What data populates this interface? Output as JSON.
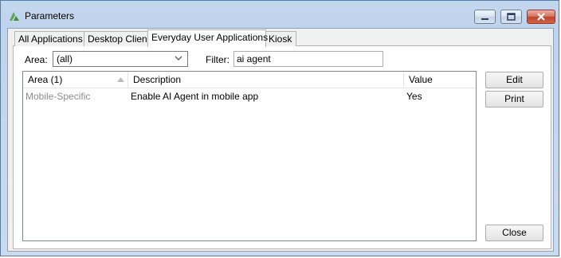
{
  "window": {
    "title": "Parameters",
    "icon": "app-logo-icon",
    "controls": [
      "minimize-icon",
      "maximize-icon",
      "close-icon"
    ]
  },
  "tabs": [
    {
      "label": "All Applications",
      "active": false
    },
    {
      "label": "Desktop Client",
      "active": false
    },
    {
      "label": "Everyday User Applications",
      "active": true
    },
    {
      "label": "Kiosk",
      "active": false
    }
  ],
  "filters": {
    "area_label": "Area:",
    "area_value": "(all)",
    "filter_label": "Filter:",
    "filter_value": "ai agent"
  },
  "grid": {
    "columns": [
      "Area (1)",
      "Description",
      "Value"
    ],
    "sort_column": "Area (1)",
    "rows": [
      {
        "area": "Mobile-Specific",
        "description": "Enable AI Agent in mobile app",
        "value": "Yes"
      }
    ]
  },
  "buttons": {
    "edit": "Edit",
    "print": "Print",
    "close": "Close"
  },
  "colors": {
    "frame": "#c3d7ee",
    "close_button": "#c2442c",
    "logo_green": "#5aa84c"
  }
}
